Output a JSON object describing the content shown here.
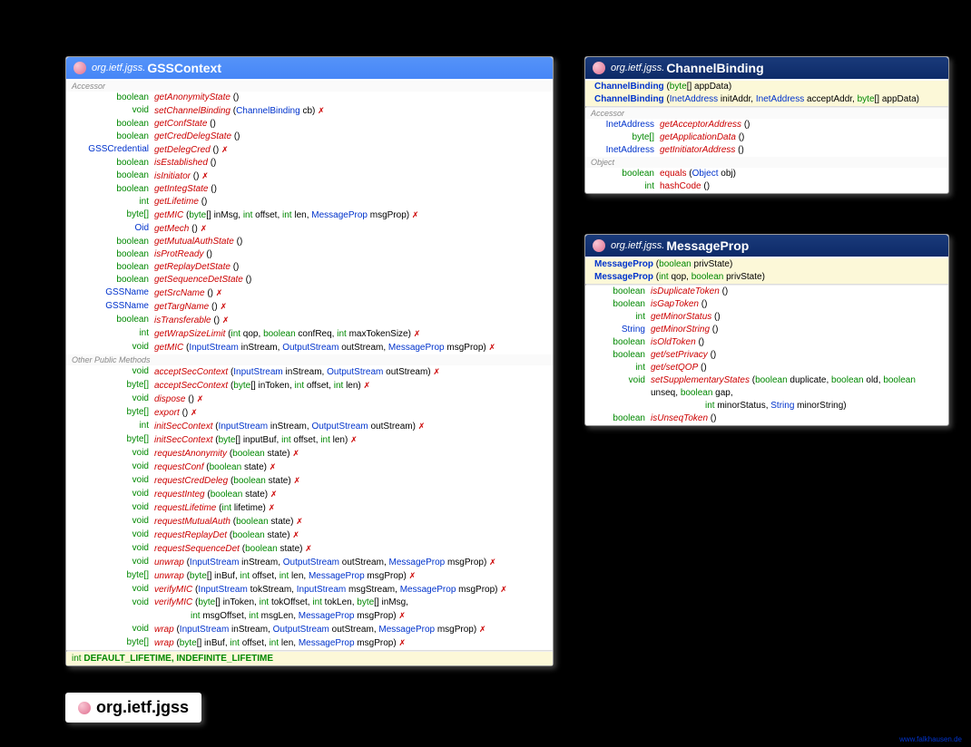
{
  "pkg": "org.ietf.jgss.",
  "gss": {
    "title": "GSSContext",
    "sec1": "Accessor",
    "sec2": "Other Public Methods",
    "accessor": [
      {
        "rt": "boolean",
        "name": "getAnonymityState",
        "sig": "()",
        "t": false
      },
      {
        "rt": "void",
        "name": "setChannelBinding",
        "sig": "(ChannelBinding cb)",
        "t": true,
        "tps": [
          "ChannelBinding"
        ]
      },
      {
        "rt": "boolean",
        "name": "getConfState",
        "sig": "()",
        "t": false
      },
      {
        "rt": "boolean",
        "name": "getCredDelegState",
        "sig": "()",
        "t": false
      },
      {
        "rt": "GSSCredential",
        "name": "getDelegCred",
        "sig": "()",
        "t": true,
        "rtb": true
      },
      {
        "rt": "boolean",
        "name": "isEstablished",
        "sig": "()",
        "t": false
      },
      {
        "rt": "boolean",
        "name": "isInitiator",
        "sig": "()",
        "t": true
      },
      {
        "rt": "boolean",
        "name": "getIntegState",
        "sig": "()",
        "t": false
      },
      {
        "rt": "int",
        "name": "getLifetime",
        "sig": "()",
        "t": false
      },
      {
        "rt": "byte[]",
        "name": "getMIC",
        "sig": "(byte[] inMsg, int offset, int len, MessageProp msgProp)",
        "t": true,
        "tps": [
          "MessageProp"
        ]
      },
      {
        "rt": "Oid",
        "name": "getMech",
        "sig": "()",
        "t": true,
        "rtb": true
      },
      {
        "rt": "boolean",
        "name": "getMutualAuthState",
        "sig": "()",
        "t": false
      },
      {
        "rt": "boolean",
        "name": "isProtReady",
        "sig": "()",
        "t": false
      },
      {
        "rt": "boolean",
        "name": "getReplayDetState",
        "sig": "()",
        "t": false
      },
      {
        "rt": "boolean",
        "name": "getSequenceDetState",
        "sig": "()",
        "t": false
      },
      {
        "rt": "GSSName",
        "name": "getSrcName",
        "sig": "()",
        "t": true,
        "rtb": true
      },
      {
        "rt": "GSSName",
        "name": "getTargName",
        "sig": "()",
        "t": true,
        "rtb": true
      },
      {
        "rt": "boolean",
        "name": "isTransferable",
        "sig": "()",
        "t": true
      },
      {
        "rt": "int",
        "name": "getWrapSizeLimit",
        "sig": "(int qop, boolean confReq, int maxTokenSize)",
        "t": true
      },
      {
        "rt": "void",
        "name": "getMIC",
        "sig": "(InputStream inStream, OutputStream outStream, MessageProp msgProp)",
        "t": true,
        "tps": [
          "InputStream",
          "OutputStream",
          "MessageProp"
        ]
      }
    ],
    "other": [
      {
        "rt": "void",
        "name": "acceptSecContext",
        "sig": "(InputStream inStream, OutputStream outStream)",
        "t": true,
        "tps": [
          "InputStream",
          "OutputStream"
        ]
      },
      {
        "rt": "byte[]",
        "name": "acceptSecContext",
        "sig": "(byte[] inToken, int offset, int len)",
        "t": true
      },
      {
        "rt": "void",
        "name": "dispose",
        "sig": "()",
        "t": true
      },
      {
        "rt": "byte[]",
        "name": "export",
        "sig": "()",
        "t": true
      },
      {
        "rt": "int",
        "name": "initSecContext",
        "sig": "(InputStream inStream, OutputStream outStream)",
        "t": true,
        "tps": [
          "InputStream",
          "OutputStream"
        ]
      },
      {
        "rt": "byte[]",
        "name": "initSecContext",
        "sig": "(byte[] inputBuf, int offset, int len)",
        "t": true
      },
      {
        "rt": "void",
        "name": "requestAnonymity",
        "sig": "(boolean state)",
        "t": true
      },
      {
        "rt": "void",
        "name": "requestConf",
        "sig": "(boolean state)",
        "t": true
      },
      {
        "rt": "void",
        "name": "requestCredDeleg",
        "sig": "(boolean state)",
        "t": true
      },
      {
        "rt": "void",
        "name": "requestInteg",
        "sig": "(boolean state)",
        "t": true
      },
      {
        "rt": "void",
        "name": "requestLifetime",
        "sig": "(int lifetime)",
        "t": true
      },
      {
        "rt": "void",
        "name": "requestMutualAuth",
        "sig": "(boolean state)",
        "t": true
      },
      {
        "rt": "void",
        "name": "requestReplayDet",
        "sig": "(boolean state)",
        "t": true
      },
      {
        "rt": "void",
        "name": "requestSequenceDet",
        "sig": "(boolean state)",
        "t": true
      },
      {
        "rt": "void",
        "name": "unwrap",
        "sig": "(InputStream inStream, OutputStream outStream, MessageProp msgProp)",
        "t": true,
        "tps": [
          "InputStream",
          "OutputStream",
          "MessageProp"
        ]
      },
      {
        "rt": "byte[]",
        "name": "unwrap",
        "sig": "(byte[] inBuf, int offset, int len, MessageProp msgProp)",
        "t": true,
        "tps": [
          "MessageProp"
        ]
      },
      {
        "rt": "void",
        "name": "verifyMIC",
        "sig": "(InputStream tokStream, InputStream msgStream, MessageProp msgProp)",
        "t": true,
        "tps": [
          "InputStream",
          "InputStream",
          "MessageProp"
        ]
      },
      {
        "rt": "void",
        "name": "verifyMIC",
        "sig": "(byte[] inToken, int tokOffset, int tokLen, byte[] inMsg, int msgOffset, int msgLen, MessageProp msgProp)",
        "t": true,
        "tps": [
          "MessageProp"
        ],
        "multi": true
      },
      {
        "rt": "void",
        "name": "wrap",
        "sig": "(InputStream inStream, OutputStream outStream, MessageProp msgProp)",
        "t": true,
        "tps": [
          "InputStream",
          "OutputStream",
          "MessageProp"
        ]
      },
      {
        "rt": "byte[]",
        "name": "wrap",
        "sig": "(byte[] inBuf, int offset, int len, MessageProp msgProp)",
        "t": true,
        "tps": [
          "MessageProp"
        ]
      }
    ],
    "constants": "DEFAULT_LIFETIME, INDEFINITE_LIFETIME"
  },
  "cb": {
    "title": "ChannelBinding",
    "ctors": [
      {
        "name": "ChannelBinding",
        "sig": "(byte[] appData)"
      },
      {
        "name": "ChannelBinding",
        "sig": "(InetAddress initAddr, InetAddress acceptAddr, byte[] appData)",
        "tps": [
          "InetAddress",
          "InetAddress"
        ]
      }
    ],
    "secA": "Accessor",
    "accessor": [
      {
        "rt": "InetAddress",
        "name": "getAcceptorAddress",
        "sig": "()",
        "rtb": true
      },
      {
        "rt": "byte[]",
        "name": "getApplicationData",
        "sig": "()"
      },
      {
        "rt": "InetAddress",
        "name": "getInitiatorAddress",
        "sig": "()",
        "rtb": true
      }
    ],
    "secO": "Object",
    "object": [
      {
        "rt": "boolean",
        "name": "equals",
        "sig": "(Object obj)",
        "plain": true,
        "tps": [
          "Object"
        ]
      },
      {
        "rt": "int",
        "name": "hashCode",
        "sig": "()",
        "plain": true
      }
    ]
  },
  "mp": {
    "title": "MessageProp",
    "ctors": [
      {
        "name": "MessageProp",
        "sig": "(boolean privState)"
      },
      {
        "name": "MessageProp",
        "sig": "(int qop, boolean privState)"
      }
    ],
    "methods": [
      {
        "rt": "boolean",
        "name": "isDuplicateToken",
        "sig": "()"
      },
      {
        "rt": "boolean",
        "name": "isGapToken",
        "sig": "()"
      },
      {
        "rt": "int",
        "name": "getMinorStatus",
        "sig": "()"
      },
      {
        "rt": "String",
        "name": "getMinorString",
        "sig": "()",
        "rtb": true
      },
      {
        "rt": "boolean",
        "name": "isOldToken",
        "sig": "()"
      },
      {
        "rt": "boolean",
        "name": "get/setPrivacy",
        "sig": "()"
      },
      {
        "rt": "int",
        "name": "get/setQOP",
        "sig": "()"
      },
      {
        "rt": "void",
        "name": "setSupplementaryStates",
        "sig": "(boolean duplicate, boolean old, boolean unseq, boolean gap, int minorStatus, String minorString)",
        "tps": [
          "String"
        ],
        "multi": true
      },
      {
        "rt": "boolean",
        "name": "isUnseqToken",
        "sig": "()"
      }
    ]
  },
  "footerPkg": "org.ietf.jgss",
  "attribution": "www.falkhausen.de"
}
